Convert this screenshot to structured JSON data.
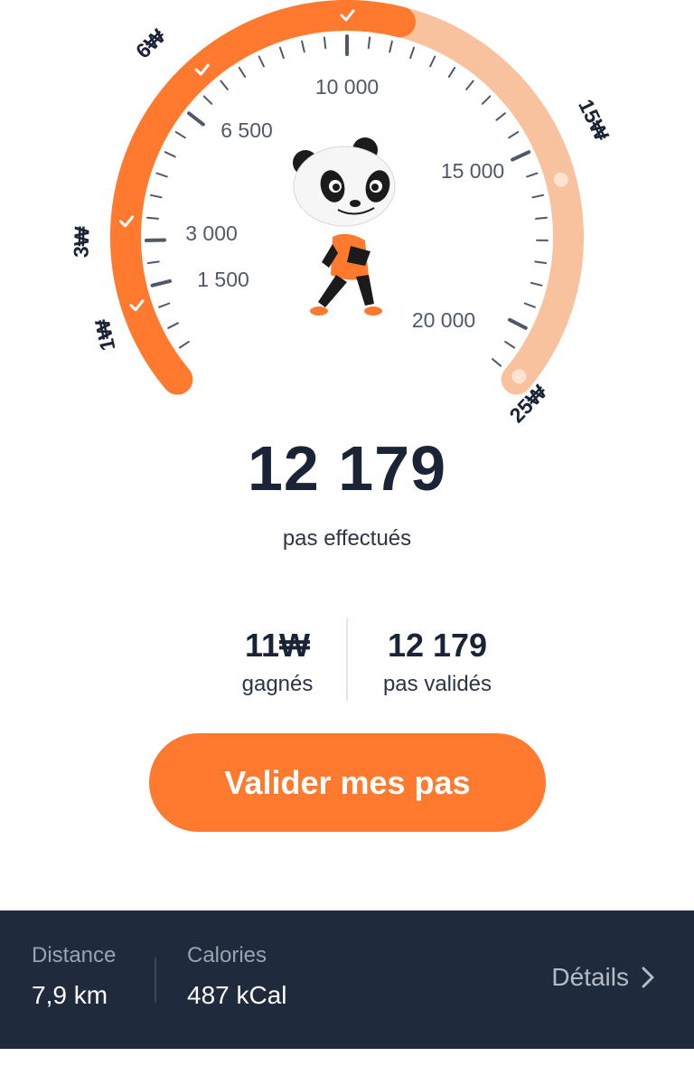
{
  "gauge": {
    "min_steps": 0,
    "max_steps": 22000,
    "current_steps": 12179,
    "step_labels": [
      "1 500",
      "3 000",
      "6 500",
      "10 000",
      "15 000",
      "20 000"
    ],
    "reward_labels": [
      "1₩",
      "3₩",
      "6₩",
      "15₩",
      "25₩"
    ],
    "reward_reached": [
      true,
      true,
      true,
      false,
      false
    ],
    "colors": {
      "progress": "#ff7a2e",
      "remaining": "#f9c29e",
      "tick": "#4f5968",
      "check": "#ffffff"
    }
  },
  "steps": {
    "count": "12 179",
    "label": "pas effectués"
  },
  "stats": {
    "earned": {
      "value": "11₩",
      "label": "gagnés"
    },
    "validated": {
      "value": "12 179",
      "label": "pas validés"
    }
  },
  "validate_button": {
    "label": "Valider mes pas"
  },
  "footer": {
    "distance": {
      "label": "Distance",
      "value": "7,9 km"
    },
    "calories": {
      "label": "Calories",
      "value": "487 kCal"
    },
    "details_label": "Détails"
  }
}
